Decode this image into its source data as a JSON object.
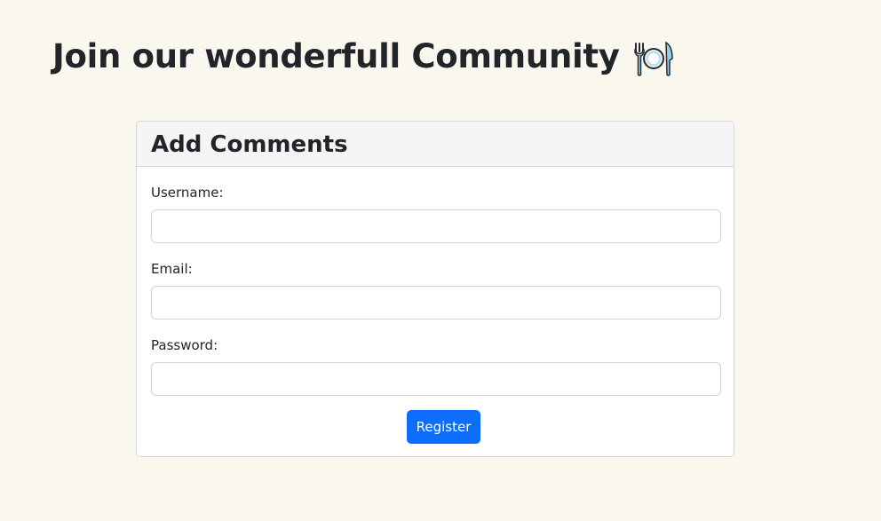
{
  "page": {
    "title": "Join our wonderfull Community",
    "title_icon": "fork-knife-plate-icon"
  },
  "form": {
    "header": "Add Comments",
    "fields": [
      {
        "label": "Username:",
        "value": "",
        "placeholder": ""
      },
      {
        "label": "Email:",
        "value": "",
        "placeholder": ""
      },
      {
        "label": "Password:",
        "value": "",
        "placeholder": ""
      }
    ],
    "submit_label": "Register"
  },
  "colors": {
    "background": "#faf8ee",
    "primary_button": "#0d6efd",
    "card_header": "#f5f5f5"
  }
}
